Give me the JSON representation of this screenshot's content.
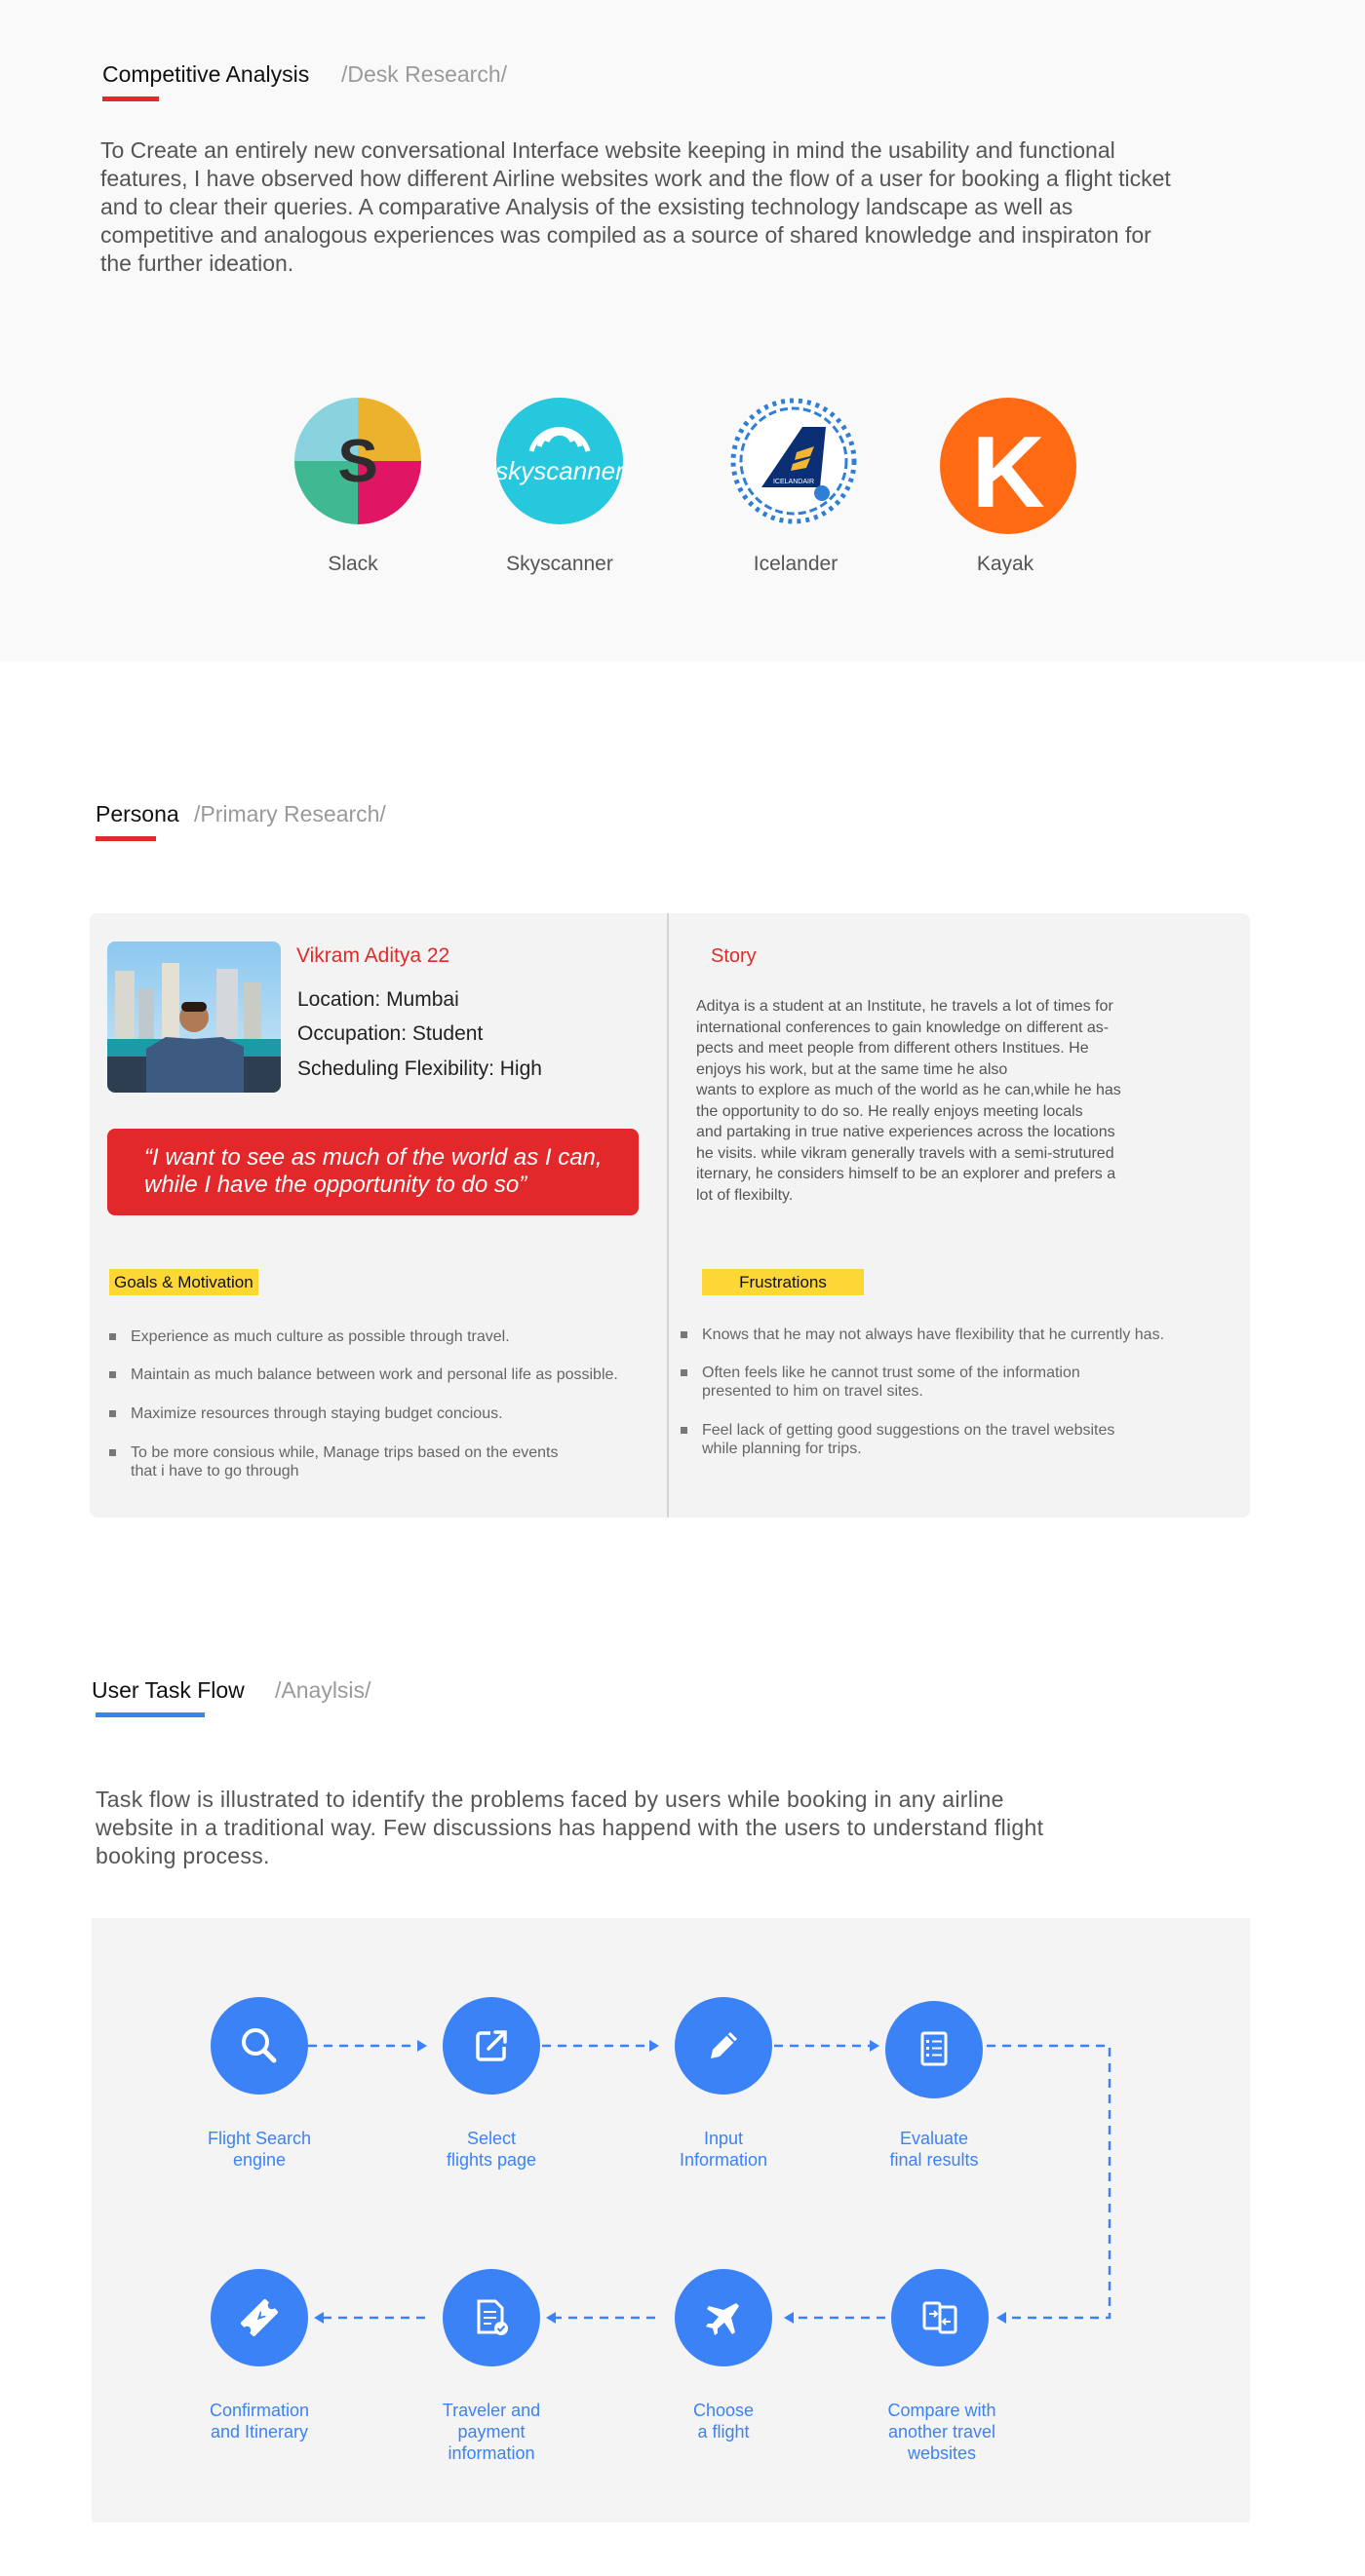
{
  "competitive": {
    "title": "Competitive Analysis",
    "subtitle": "/Desk Research/",
    "description": "To Create an entirely new conversational Interface website keeping in mind the usability and functional features, I have observed how different Airline websites work and the flow of a user for booking a flight ticket and to clear their queries. A comparative Analysis of the exsisting technology landscape as well as competitive and analogous experiences was compiled as a source of shared knowledge and inspiraton for the further ideation.",
    "logos": [
      {
        "name": "Slack",
        "glyph": "S"
      },
      {
        "name": "Skyscanner",
        "glyph": "skyscanner"
      },
      {
        "name": "Icelander",
        "glyph": "ICELANDAIR"
      },
      {
        "name": "Kayak",
        "glyph": "K"
      }
    ]
  },
  "persona": {
    "title": "Persona",
    "subtitle": "/Primary Research/",
    "name": "Vikram Aditya 22",
    "location": "Location: Mumbai",
    "occupation": "Occupation: Student",
    "flexibility": "Scheduling Flexibility: High",
    "quote_line1": "“I want to see as much of the world as I can,",
    "quote_line2": "while I have the opportunity to do so”",
    "story_title": "Story",
    "story_lines": [
      "Aditya is a student at an Institute, he travels a lot of times for",
      "international conferences to gain knowledge on different as-",
      "pects and meet people from different others Institues. He",
      "enjoys his work, but at the same time he also",
      "wants to explore as much of the world as he can,while he has",
      "the opportunity to do so. He really enjoys meeting locals",
      "and partaking in true native experiences across the locations",
      "he visits. while vikram generally travels with a semi-strutured",
      "iternary, he considers himself to be an explorer and prefers a",
      "lot of flexibilty."
    ],
    "goals_title": "Goals & Motivation",
    "goals": [
      " Experience as much culture as possible through travel.",
      "Maintain as much balance between work and personal life as possible.",
      "Maximize resources through staying budget concious.",
      "To be more consious while, Manage trips based on the events\nthat i have to go through"
    ],
    "frustrations_title": "Frustrations",
    "frustrations": [
      "Knows that he may not always have flexibility that he currently has.",
      "Often feels like he cannot trust some of the information\npresented to him on travel sites.",
      "Feel lack of getting good suggestions on the travel websites\nwhile planning for trips."
    ]
  },
  "taskflow": {
    "title": "User Task Flow",
    "subtitle": "/Anaylsis/",
    "description": "Task flow is illustrated to identify the problems faced by users while booking in any airline website in a traditional way. Few discussions has happend with the users to understand flight booking process.",
    "steps": [
      {
        "label": "Flight Search\nengine",
        "icon": "search-icon"
      },
      {
        "label": "Select\nflights page",
        "icon": "external-link-icon"
      },
      {
        "label": "Input\nInformation",
        "icon": "pencil-icon"
      },
      {
        "label": "Evaluate\nfinal results",
        "icon": "document-list-icon"
      },
      {
        "label": "Compare with\nanother travel\nwebsites",
        "icon": "compare-icon"
      },
      {
        "label": "Choose\na flight",
        "icon": "airplane-icon"
      },
      {
        "label": "Traveler and\npayment\ninformation",
        "icon": "document-check-icon"
      },
      {
        "label": "Confirmation\nand Itinerary",
        "icon": "ticket-icon"
      }
    ]
  },
  "colors": {
    "accent_red": "#e02a2a",
    "accent_blue": "#3b82f6",
    "highlight_yellow": "#fdd835"
  }
}
